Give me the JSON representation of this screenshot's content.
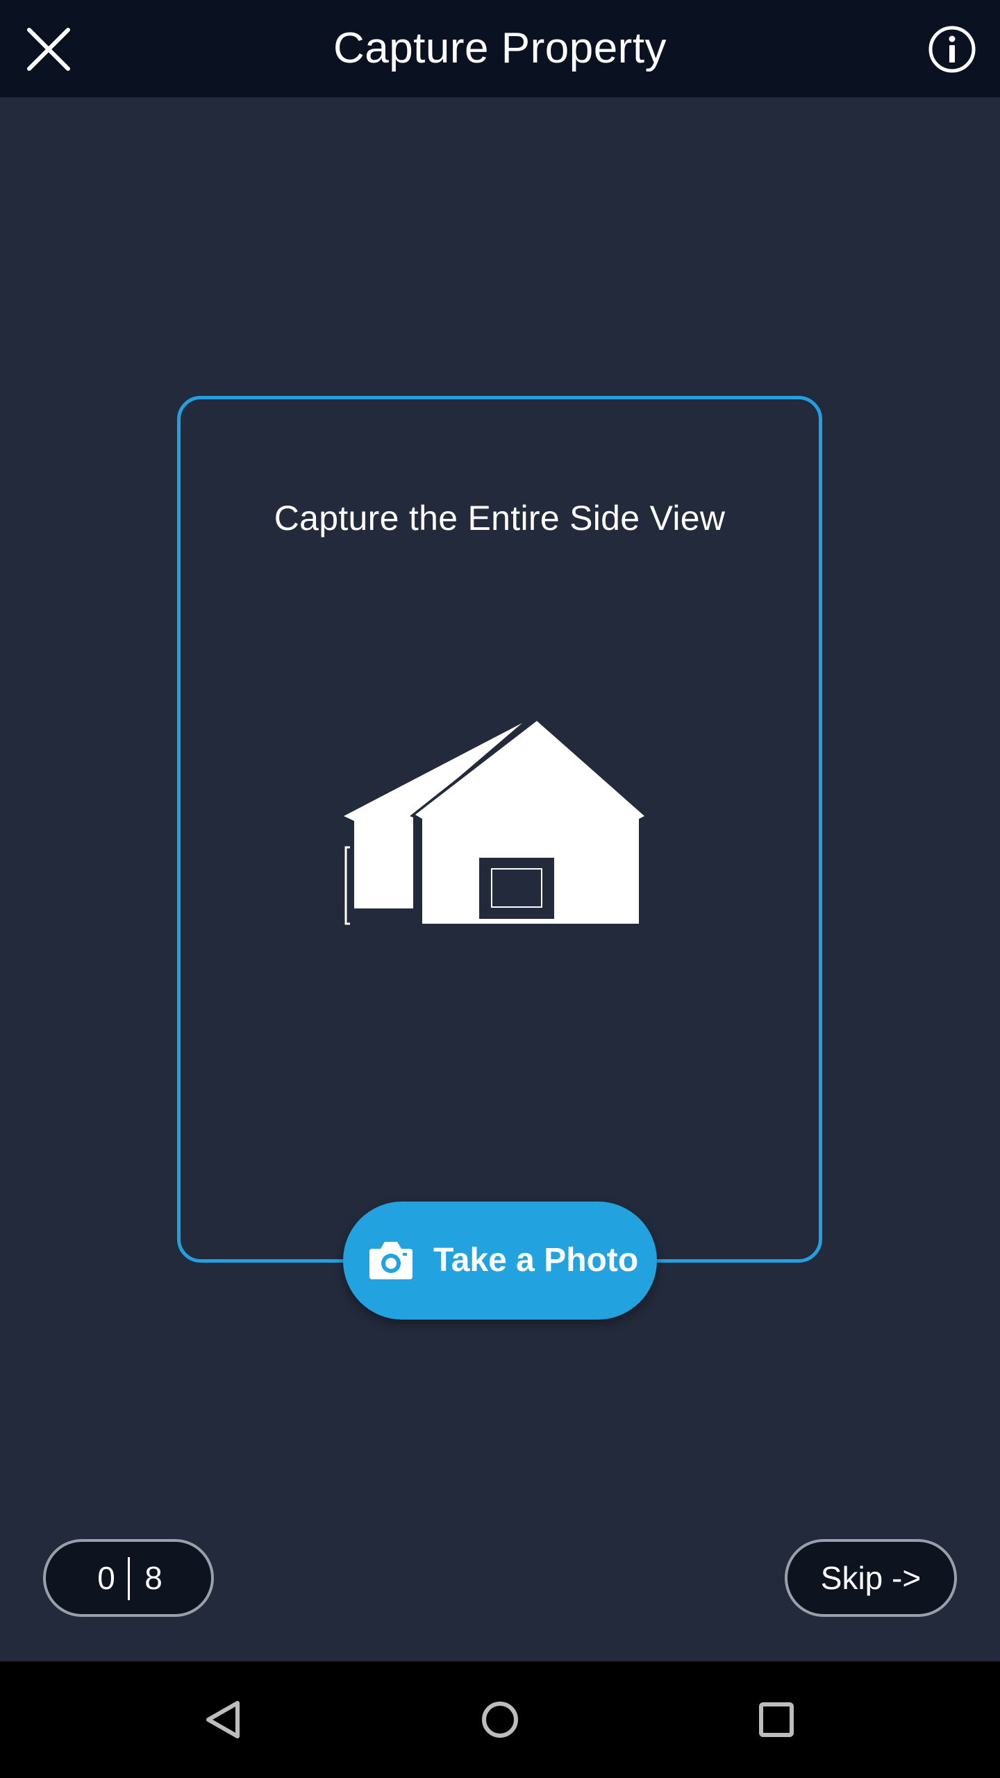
{
  "header": {
    "title": "Capture Property",
    "close_icon": "close-icon",
    "info_icon": "info-icon"
  },
  "capture": {
    "instruction": "Capture the Entire Side View",
    "illustration": "house-side-view-icon"
  },
  "take_photo": {
    "label": "Take a Photo",
    "icon": "camera-icon"
  },
  "progress": {
    "current": "0",
    "total": "8"
  },
  "skip": {
    "label": "Skip ->"
  },
  "nav": {
    "back_icon": "back-icon",
    "home_icon": "home-icon",
    "recents_icon": "recents-icon"
  },
  "colors": {
    "background": "#232a3b",
    "header": "#0a1121",
    "accent": "#22a3e0",
    "pill_background": "#0e1320",
    "pill_border": "#9aa0aa"
  }
}
